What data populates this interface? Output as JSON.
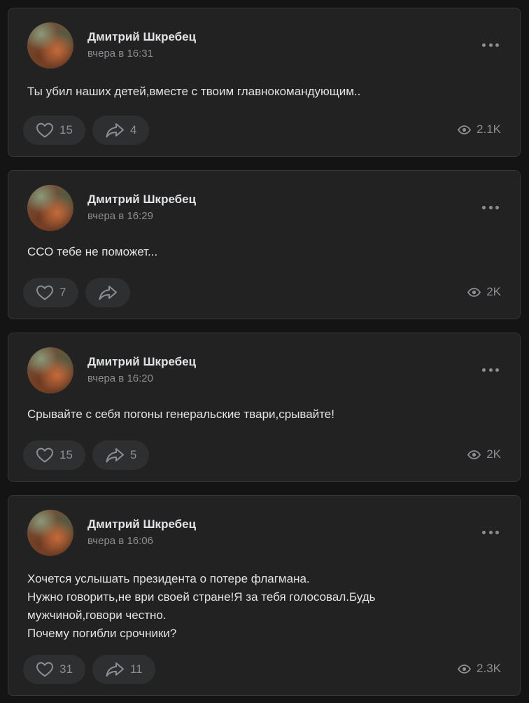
{
  "posts": [
    {
      "author": "Дмитрий Шкребец",
      "time": "вчера в 16:31",
      "lines": [
        "Ты убил наших детей,вместе с твоим главнокомандующим.."
      ],
      "likes": "15",
      "shares": "4",
      "views": "2.1K"
    },
    {
      "author": "Дмитрий Шкребец",
      "time": "вчера в 16:29",
      "lines": [
        "ССО тебе не поможет..."
      ],
      "likes": "7",
      "shares": "",
      "views": "2K"
    },
    {
      "author": "Дмитрий Шкребец",
      "time": "вчера в 16:20",
      "lines": [
        "Срывайте с себя погоны генеральские твари,срывайте!"
      ],
      "likes": "15",
      "shares": "5",
      "views": "2K"
    },
    {
      "author": "Дмитрий Шкребец",
      "time": "вчера в 16:06",
      "lines": [
        "Хочется услышать президента о потере флагмана.",
        "Нужно говорить,не ври своей стране!Я за тебя голосовал.Будь",
        "мужчиной,говори честно.",
        "Почему погибли срочники?"
      ],
      "likes": "31",
      "shares": "11",
      "views": "2.3K"
    }
  ],
  "icons": {
    "like": "heart-icon",
    "share": "share-arrow-icon",
    "views": "eye-icon",
    "more": "more-dots-icon"
  },
  "colors": {
    "page_bg": "#141414",
    "card_bg": "#222222",
    "card_border": "#363738",
    "text_primary": "#e1e3e6",
    "text_secondary": "#8b8e93",
    "button_bg": "#2e2f30"
  }
}
